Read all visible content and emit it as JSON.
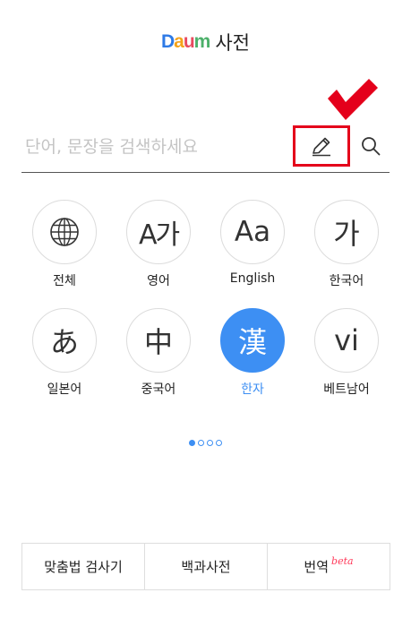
{
  "header": {
    "logo": {
      "letters": [
        "D",
        "a",
        "u",
        "m"
      ],
      "colors": [
        "#2e7ae6",
        "#f5a31a",
        "#e84a5f",
        "#4cb06a"
      ]
    },
    "title": "사전"
  },
  "search": {
    "placeholder": "단어, 문장을 검색하세요",
    "value": "",
    "pen_icon": "pen-icon",
    "search_icon": "search-icon",
    "highlight_color": "#e4001b"
  },
  "languages": [
    {
      "symbol": "",
      "icon": "globe-icon",
      "label": "전체",
      "active": false
    },
    {
      "symbol": "A가",
      "label": "영어",
      "active": false
    },
    {
      "symbol": "Aa",
      "label": "English",
      "active": false
    },
    {
      "symbol": "가",
      "label": "한국어",
      "active": false
    },
    {
      "symbol": "あ",
      "label": "일본어",
      "active": false
    },
    {
      "symbol": "中",
      "label": "중국어",
      "active": false
    },
    {
      "symbol": "漢",
      "label": "한자",
      "active": true
    },
    {
      "symbol": "vi",
      "label": "베트남어",
      "active": false
    }
  ],
  "pagination": {
    "total": 4,
    "current": 1
  },
  "bottom_bar": {
    "spell_check": "맞춤법 검사기",
    "encyclopedia": "백과사전",
    "translate": "번역",
    "translate_badge": "beta"
  },
  "accent_color": "#3d8ff3"
}
